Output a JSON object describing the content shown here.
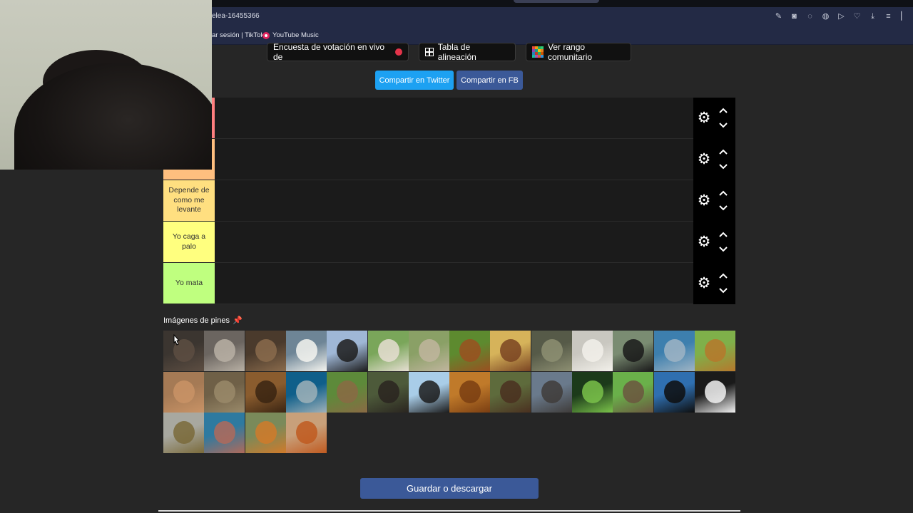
{
  "browser": {
    "url_fragment": "elea-16455366",
    "bookmarks": [
      {
        "label": "ar sesión | TikTok"
      },
      {
        "label": "YouTube Music"
      }
    ],
    "toolbar_icons": [
      "edit-icon",
      "camera-icon",
      "circle-check-icon",
      "globe-icon",
      "play-icon",
      "heart-icon",
      "download-icon",
      "menu-icon",
      "profile-icon"
    ]
  },
  "top_buttons": {
    "live_poll": "Encuesta de votación en vivo de",
    "alignment_chart": "Tabla de alineación",
    "community_rank": "Ver rango comunitario"
  },
  "share": {
    "twitter": "Compartir en Twitter",
    "facebook": "Compartir en FB",
    "twitter_color": "#1da1f2",
    "facebook_color": "#3b5998"
  },
  "tiers": [
    {
      "label": "",
      "color": "#ff7f7f"
    },
    {
      "label": "",
      "color": "#ffbf7f"
    },
    {
      "label": "Depende de como me levante",
      "color": "#ffdf80"
    },
    {
      "label": "Yo caga a palo",
      "color": "#ffff7f"
    },
    {
      "label": "Yo mata",
      "color": "#bfff7f"
    }
  ],
  "pins": {
    "title": "Imágenes de pines",
    "items": [
      "platypus",
      "wolf",
      "donkey",
      "eagle",
      "cow",
      "goat",
      "sloth",
      "hen",
      "guinea-pig",
      "crocodile",
      "sheep",
      "gorilla",
      "dolphin",
      "squirrel",
      "kangaroo",
      "hippo",
      "scorpion",
      "shark",
      "capybara",
      "wild-boar",
      "penguin",
      "lion",
      "moose",
      "rhino",
      "snake",
      "otter",
      "orca",
      "panda",
      "carp",
      "octopus",
      "tiger",
      "fox"
    ]
  },
  "save_button": "Guardar o descargar"
}
